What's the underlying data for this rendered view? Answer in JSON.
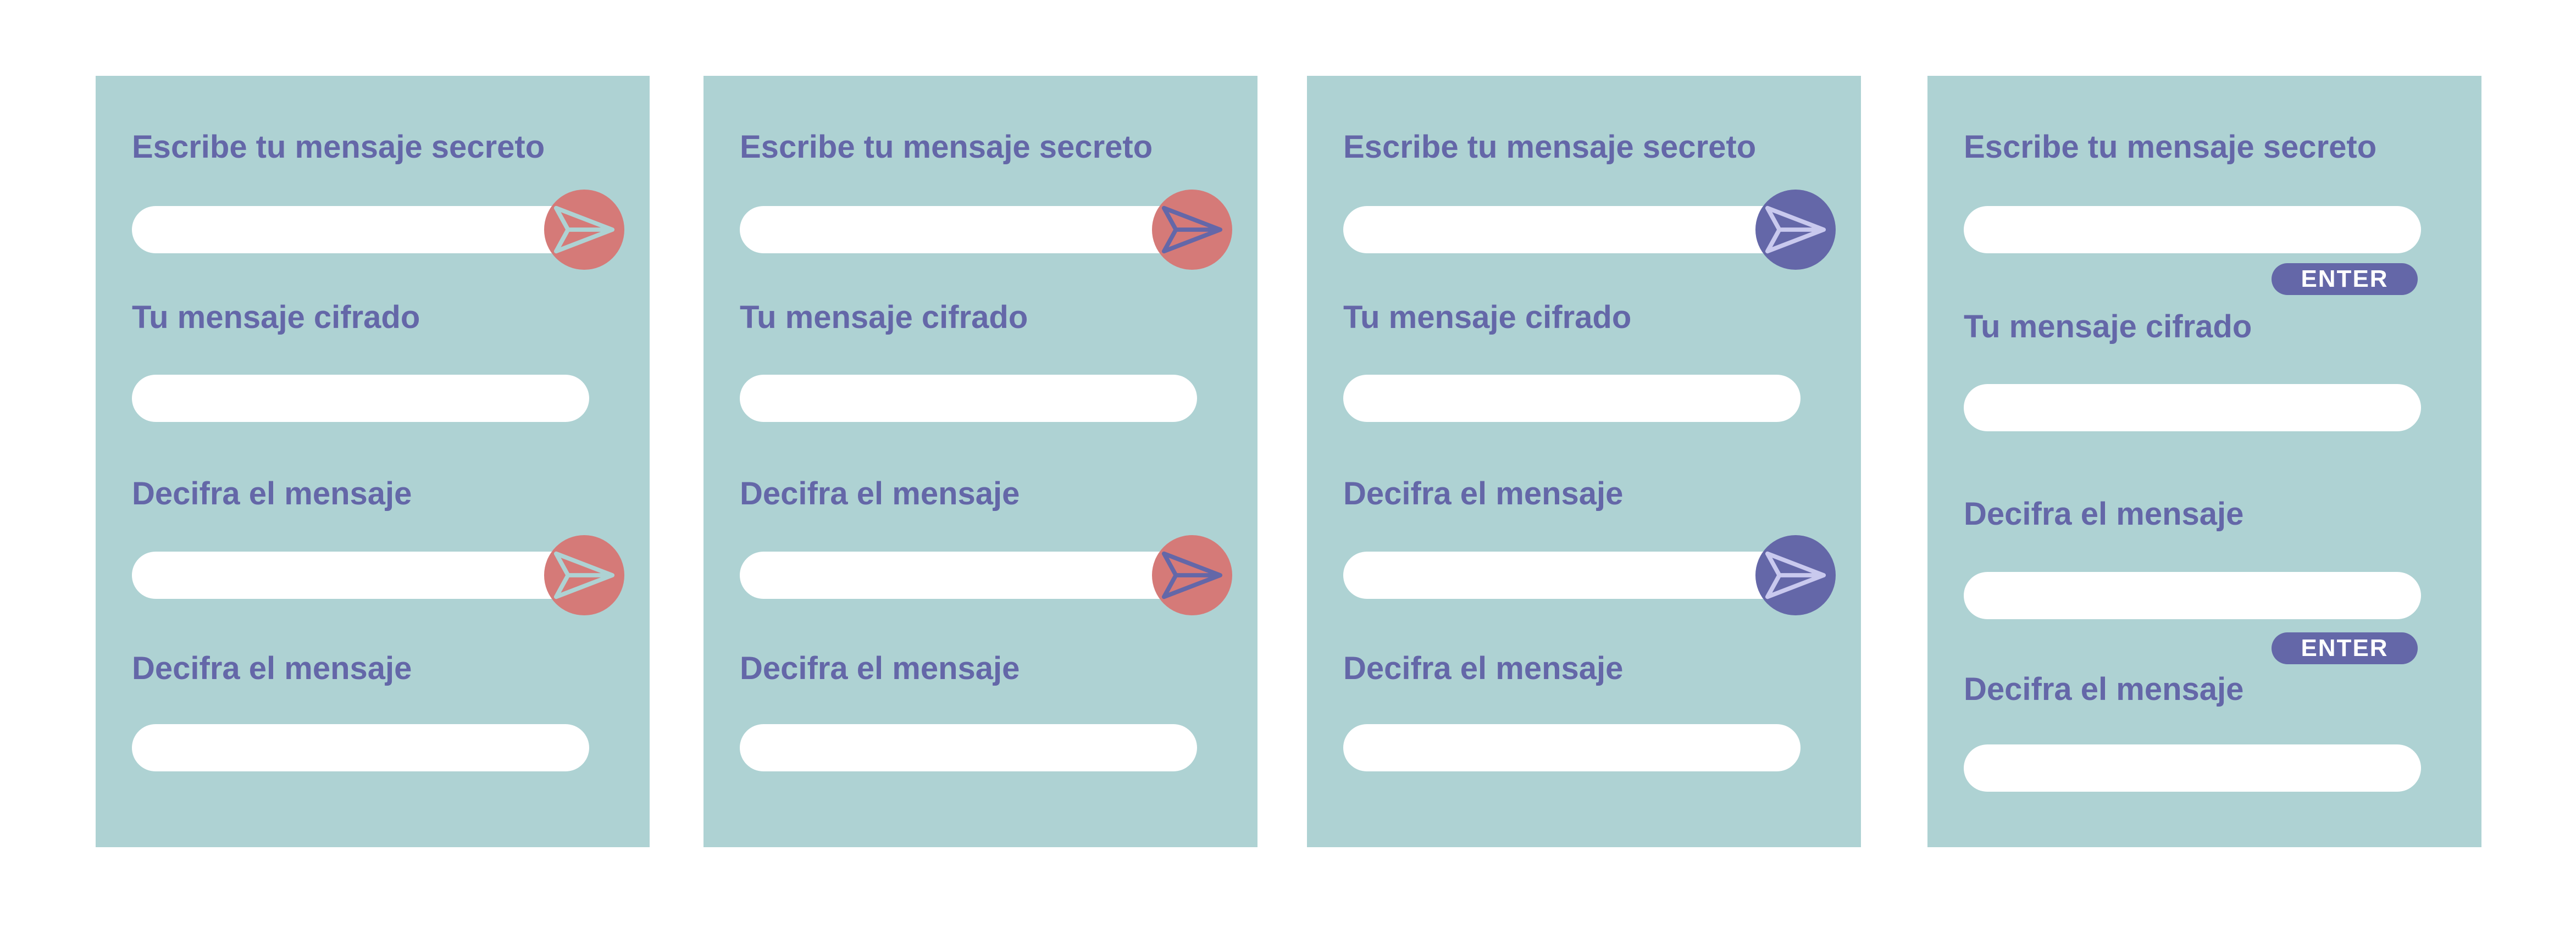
{
  "colors": {
    "panel_background": "#aed2d3",
    "label_text": "#6467a8",
    "field_background": "#ffffff",
    "send_button_coral": "#d57a78",
    "send_button_purple": "#6467a8",
    "enter_button": "#6467a8",
    "icon_light_blue": "#aed2d3",
    "icon_purple": "#6467a8",
    "icon_lavender": "#c9c9ee"
  },
  "panels": [
    {
      "variant": "coral-send-light-icon",
      "labels": {
        "secret": "Escribe tu mensaje secreto",
        "encrypted": "Tu mensaje cifrado",
        "decrypt_input": "Decifra el mensaje",
        "decrypt_output": "Decifra el mensaje"
      },
      "values": {
        "secret": "",
        "encrypted": "",
        "decrypt_input": "",
        "decrypt_output": ""
      },
      "send_icon": "paper-plane-icon"
    },
    {
      "variant": "coral-send-purple-icon",
      "labels": {
        "secret": "Escribe tu mensaje secreto",
        "encrypted": "Tu mensaje cifrado",
        "decrypt_input": "Decifra el mensaje",
        "decrypt_output": "Decifra el mensaje"
      },
      "values": {
        "secret": "",
        "encrypted": "",
        "decrypt_input": "",
        "decrypt_output": ""
      },
      "send_icon": "paper-plane-icon"
    },
    {
      "variant": "purple-send-lavender-icon",
      "labels": {
        "secret": "Escribe tu mensaje secreto",
        "encrypted": "Tu mensaje cifrado",
        "decrypt_input": "Decifra el mensaje",
        "decrypt_output": "Decifra el mensaje"
      },
      "values": {
        "secret": "",
        "encrypted": "",
        "decrypt_input": "",
        "decrypt_output": ""
      },
      "send_icon": "paper-plane-icon"
    },
    {
      "variant": "enter-pill-buttons",
      "labels": {
        "secret": "Escribe tu mensaje secreto",
        "encrypted": "Tu mensaje cifrado",
        "decrypt_input": "Decifra el mensaje",
        "decrypt_output": "Decifra el mensaje"
      },
      "values": {
        "secret": "",
        "encrypted": "",
        "decrypt_input": "",
        "decrypt_output": ""
      },
      "enter_label_1": "ENTER",
      "enter_label_2": "ENTER"
    }
  ]
}
